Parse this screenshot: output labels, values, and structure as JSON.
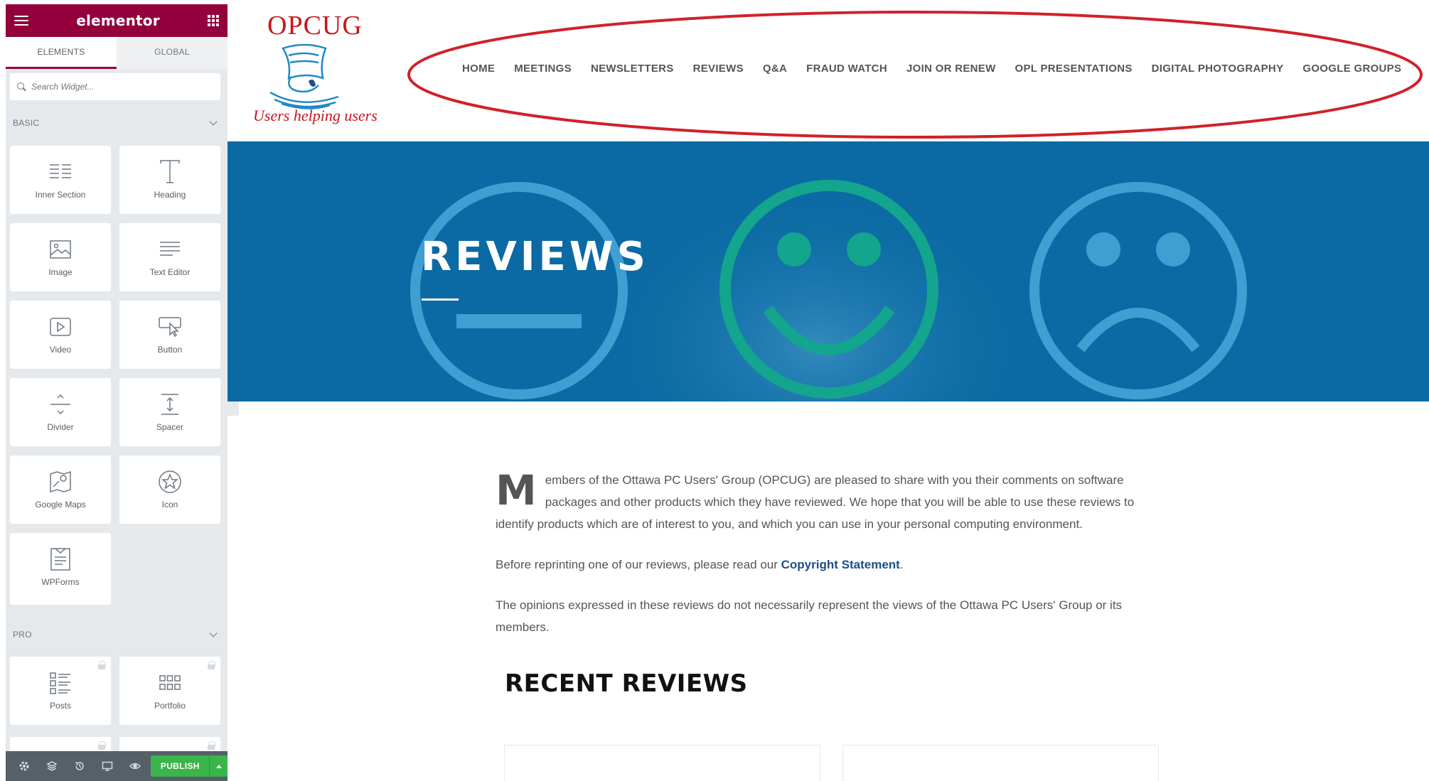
{
  "panel": {
    "brand": "elementor",
    "tabs": [
      "ELEMENTS",
      "GLOBAL"
    ],
    "search_placeholder": "Search Widget...",
    "basic_label": "BASIC",
    "pro_label": "PRO",
    "basic_widgets": [
      "Inner Section",
      "Heading",
      "Image",
      "Text Editor",
      "Video",
      "Button",
      "Divider",
      "Spacer",
      "Google Maps",
      "Icon",
      "WPForms"
    ],
    "pro_widgets": [
      "Posts",
      "Portfolio"
    ],
    "publish_label": "PUBLISH",
    "accent": "#93003c"
  },
  "site": {
    "logo_text": "OPCUG",
    "logo_tagline": "Users helping users",
    "nav": [
      "HOME",
      "MEETINGS",
      "NEWSLETTERS",
      "REVIEWS",
      "Q&A",
      "FRAUD WATCH",
      "JOIN OR RENEW",
      "OPL PRESENTATIONS",
      "DIGITAL PHOTOGRAPHY",
      "GOOGLE GROUPS"
    ],
    "hero_title": "REVIEWS",
    "hero_color": "#0b6aa3",
    "annotation_color": "#d0212a",
    "intro_dropcap": "M",
    "intro_text": "embers of the Ottawa PC Users' Group (OPCUG) are pleased to share with you their comments on software packages and other products which they have reviewed. We hope that you will be able to use these reviews to identify products which are of interest to you, and which you can use in your personal computing environment.",
    "reprint_text": "Before reprinting one of our reviews, please read our",
    "reprint_link": "Copyright Statement",
    "reprint_end": ".",
    "opinion_text": "The opinions expressed in these reviews do not necessarily represent the views of the Ottawa PC Users' Group or its members.",
    "recent_title": "RECENT REVIEWS"
  }
}
